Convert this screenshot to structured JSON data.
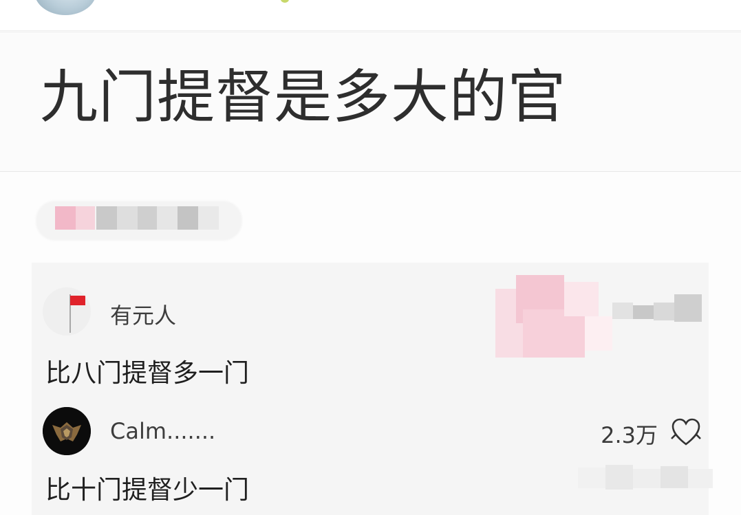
{
  "question": {
    "title": "九门提督是多大的官"
  },
  "comments": [
    {
      "avatar_icon": "flag-icon",
      "username": "有元人",
      "text": "比八门提督多一门"
    },
    {
      "avatar_icon": "badge-emblem-icon",
      "username": "Calm.......",
      "like_count": "2.3万",
      "like_icon": "heart-icon",
      "text": "比十门提督少一门"
    }
  ],
  "colors": {
    "flag_red": "#e0232b",
    "text_dark": "#1f1f1f",
    "panel_bg": "#f5f5f5"
  }
}
